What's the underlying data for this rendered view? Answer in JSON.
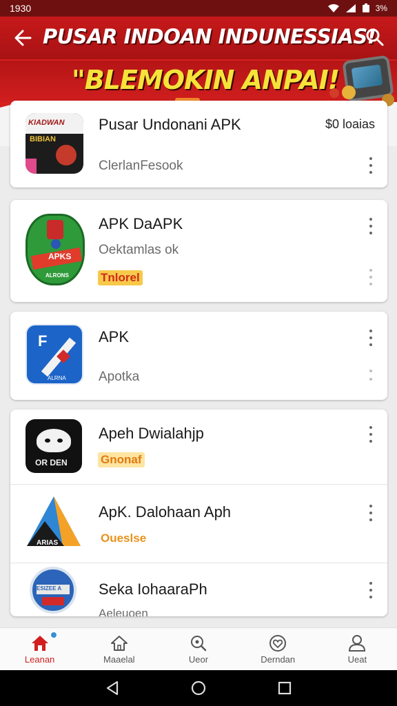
{
  "status_bar": {
    "time": "1930",
    "battery": "3%"
  },
  "header": {
    "title": "PUSAR INDOAN INDUNESSIAS!",
    "promo": "\"BLEMOKIN ANPAI!"
  },
  "apps": [
    {
      "name": "Pusar Undonani   APK",
      "subtitle": "ClerlanFesook",
      "price": "$0 loaias",
      "badge": "",
      "icon": "kiadwan-bibian-icon",
      "icon_text_1": "KIADWAN",
      "icon_text_2": "BIBIAN"
    },
    {
      "name": "APK DaAPK",
      "subtitle": "Oektamlas ok",
      "badge": "Tnlorel",
      "icon": "apks-soccer-icon",
      "icon_text_1": "APKS",
      "icon_text_2": "ALRONS"
    },
    {
      "name": "APK",
      "subtitle": "Apotka",
      "badge": "",
      "icon": "f-plane-icon",
      "icon_text_1": "F",
      "icon_text_2": "ALRNA"
    },
    {
      "name": "Apeh Dwialahjp",
      "subtitle": "",
      "badge": "Gnonaf",
      "icon": "ufo-icon",
      "icon_text_1": "OR DEN"
    },
    {
      "name": "ApK. Dalohaan Aph",
      "subtitle": "",
      "badge": "Oueslse",
      "icon": "arias-triangle-icon",
      "icon_text_1": "ARIAS"
    },
    {
      "name": "Seka IohaaraPh",
      "subtitle": "Aeleuoen",
      "badge": "",
      "icon": "globe-badge-icon",
      "icon_text_1": "ESIZEE A"
    }
  ],
  "bottom_nav": [
    {
      "label": "Leanan",
      "icon": "home-icon",
      "active": true
    },
    {
      "label": "Maaelal",
      "icon": "house-outline-icon",
      "active": false
    },
    {
      "label": "Ueor",
      "icon": "search-icon",
      "active": false
    },
    {
      "label": "Derndan",
      "icon": "heart-icon",
      "active": false
    },
    {
      "label": "Ueat",
      "icon": "user-icon",
      "active": false
    }
  ],
  "colors": {
    "brand_red": "#d7201f",
    "promo_yellow": "#f6e33a",
    "active_nav": "#d11f1f"
  }
}
